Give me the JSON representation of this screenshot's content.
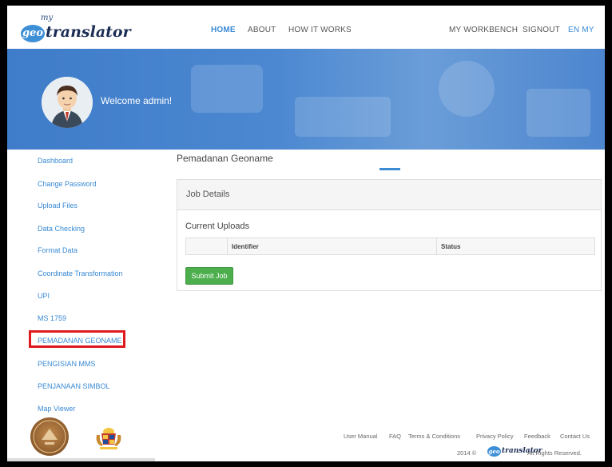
{
  "brand": {
    "my": "my",
    "geo": "geo",
    "translator": "translator"
  },
  "nav": {
    "home": "HOME",
    "about": "ABOUT",
    "how_it_works": "HOW IT WORKS",
    "workbench": "MY WORKBENCH",
    "signout": "SIGNOUT",
    "lang": "EN MY"
  },
  "banner": {
    "welcome": "Welcome admin!"
  },
  "sidebar": {
    "items": [
      "Dashboard",
      "Change Password",
      "Upload Files",
      "Data Checking",
      "Format Data",
      "Coordinate Transformation",
      "UPI",
      "MS 1759",
      "PEMADANAN GEONAME",
      "PENGISIAN MMS",
      "PENJANAAN SIMBOL",
      "Map Viewer"
    ]
  },
  "main": {
    "title": "Pemadanan Geoname",
    "panel_title": "Job Details",
    "uploads_label": "Current Uploads",
    "columns": [
      "",
      "Identifier",
      "Status"
    ],
    "submit": "Submit Job"
  },
  "footer": {
    "links": [
      "User Manual",
      "FAQ",
      "Terms & Conditions",
      "Privacy Policy",
      "Feedback",
      "Contact Us"
    ],
    "copyright": "2014 ©",
    "rights": "All Rights Reserved."
  },
  "colors": {
    "accent": "#3a8ad4",
    "banner": "#4c88d1",
    "highlight": "#e0191e",
    "submit": "#4cae4c"
  }
}
